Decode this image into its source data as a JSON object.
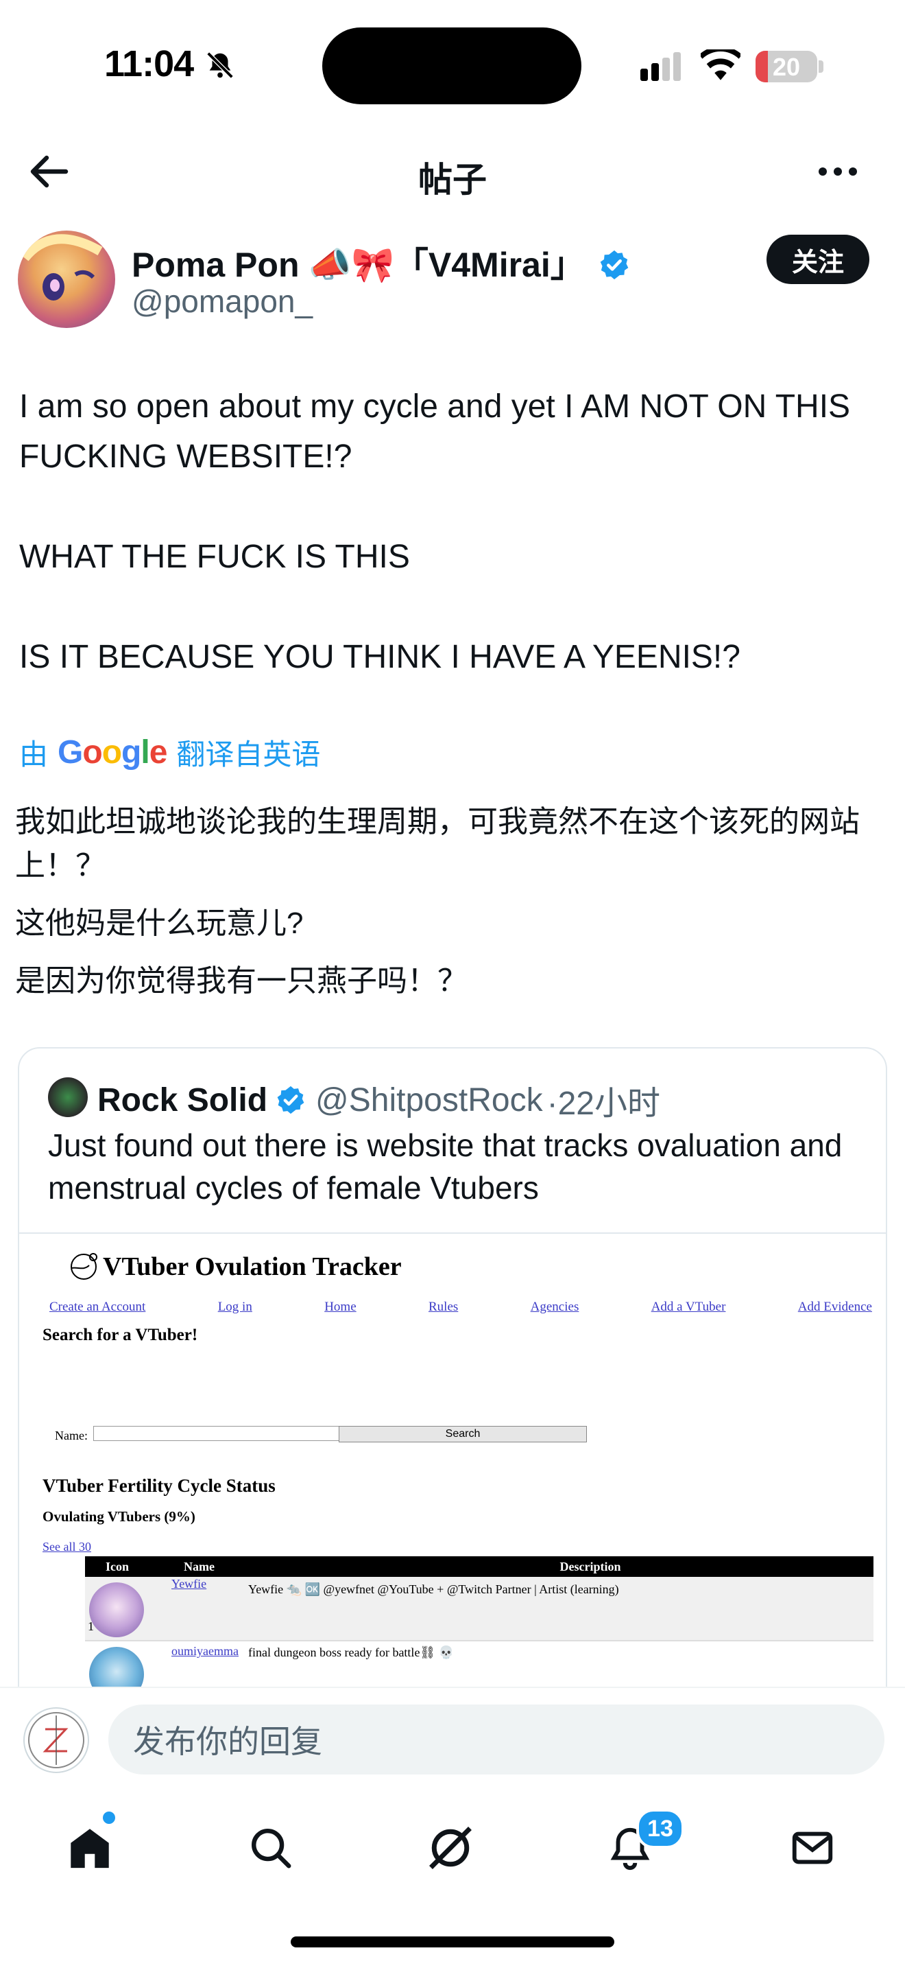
{
  "status_bar": {
    "time": "11:04",
    "battery": "20",
    "battery_level": 0.2
  },
  "header": {
    "title": "帖子"
  },
  "post": {
    "author_name": "Poma Pon 📣🎀「V4Mirai」",
    "author_handle": "@pomapon_",
    "follow_label": "关注",
    "paragraphs": [
      "I am so open about my cycle and yet I AM NOT ON THIS FUCKING WEBSITE!?",
      "WHAT THE FUCK IS THIS",
      "IS IT BECAUSE YOU THINK I HAVE A YEENIS!?"
    ],
    "translate_prefix": "由",
    "translate_brand": "Google",
    "translate_suffix": "翻译自英语",
    "translation": [
      "我如此坦诚地谈论我的生理周期，可我竟然不在这个该死的网站上！？",
      "这他妈是什么玩意儿?",
      "是因为你觉得我有一只燕子吗！？"
    ]
  },
  "quote": {
    "name": "Rock Solid",
    "handle": "@ShitpostRock",
    "time": "·22小时",
    "text": "Just found out there is website that tracks ovaluation and menstrual cycles of female Vtubers",
    "site": {
      "title": "VTuber Ovulation Tracker",
      "nav": [
        "Create an Account",
        "Log in",
        "Home",
        "Rules",
        "Agencies",
        "Add a VTuber",
        "Add Evidence"
      ],
      "search_heading": "Search for a VTuber!",
      "name_label": "Name:",
      "search_button": "Search",
      "status_heading": "VTuber Fertility Cycle Status",
      "ovulating_heading": "Ovulating VTubers (9%)",
      "see_all": "See all 30",
      "columns": [
        "Icon",
        "Name",
        "Description"
      ],
      "rows": [
        {
          "num": "1",
          "name": "Yewfie",
          "desc": "Yewfie 🐀 🆗 @yewfnet @YouTube + @Twitch Partner | Artist (learning)"
        },
        {
          "num": "",
          "name": "oumiyaemma",
          "desc": "final dungeon boss ready for battle⛓ 💀"
        }
      ]
    }
  },
  "reply": {
    "placeholder": "发布你的回复"
  },
  "tabbar": {
    "notifications_count": "13"
  },
  "colors": {
    "accent": "#1d9bf0",
    "text": "#0f1419",
    "muted": "#536471"
  }
}
